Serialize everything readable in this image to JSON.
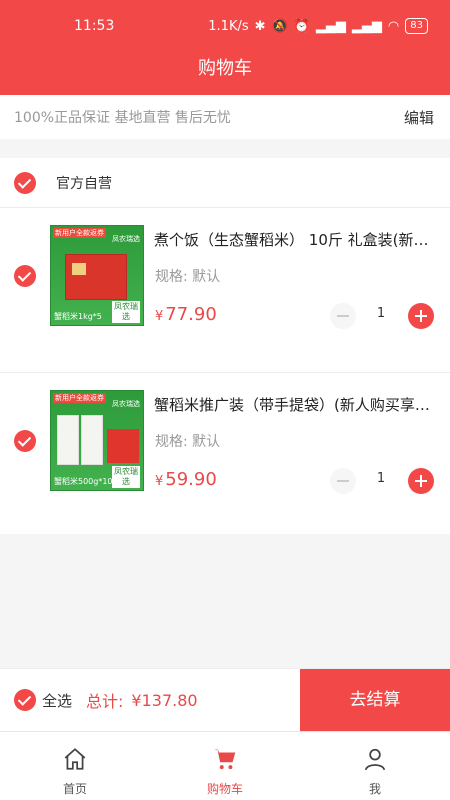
{
  "status_bar": {
    "time": "11:53",
    "network_speed": "1.1K/s",
    "battery": "83"
  },
  "header": {
    "title": "购物车"
  },
  "notice": {
    "text": "100%正品保证 基地直营 售后无忧",
    "edit_label": "编辑"
  },
  "shop": {
    "name": "官方自营",
    "items": [
      {
        "title": "煮个饭（生态蟹稻米） 10斤 礼盒装(新人购买...",
        "spec": "规格: 默认",
        "currency": "¥",
        "price": "77.90",
        "quantity": "1",
        "image": {
          "top_banner": "新用户全款返券",
          "logo": "凤农瑞选",
          "bottom_text": "蟹稻米1kg*5",
          "badge": "凤农瑞选"
        }
      },
      {
        "title": "蟹稻米推广装（带手提袋）(新人购买享优惠)",
        "spec": "规格: 默认",
        "currency": "¥",
        "price": "59.90",
        "quantity": "1",
        "image": {
          "top_banner": "新用户全款返券",
          "logo": "凤农瑞选",
          "bottom_text": "蟹稻米500g*10",
          "badge": "凤农瑞选"
        }
      }
    ]
  },
  "checkout": {
    "select_all_label": "全选",
    "total_label": "总计:",
    "total_amount": "¥137.80",
    "button_label": "去结算"
  },
  "tabbar": {
    "tabs": [
      {
        "label": "首页",
        "icon": "home-icon"
      },
      {
        "label": "购物车",
        "icon": "cart-icon",
        "active": true
      },
      {
        "label": "我",
        "icon": "user-icon"
      }
    ]
  },
  "colors": {
    "accent": "#f24848",
    "price": "#e84a4a"
  }
}
